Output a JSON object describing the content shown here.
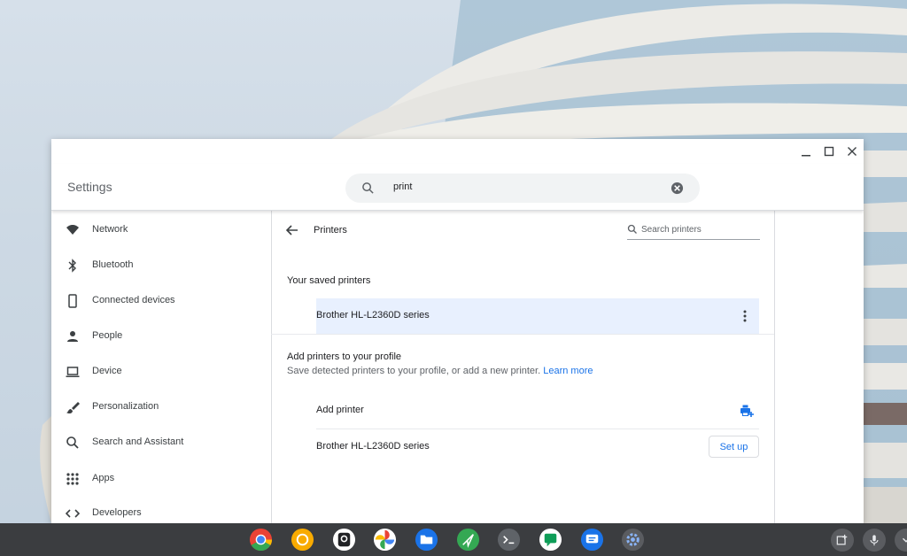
{
  "window": {
    "app_title": "Settings",
    "search": {
      "query": "print"
    }
  },
  "sidebar": {
    "items": [
      {
        "label": "Network",
        "icon": "wifi-icon"
      },
      {
        "label": "Bluetooth",
        "icon": "bluetooth-icon"
      },
      {
        "label": "Connected devices",
        "icon": "phone-icon"
      },
      {
        "label": "People",
        "icon": "person-icon"
      },
      {
        "label": "Device",
        "icon": "laptop-icon"
      },
      {
        "label": "Personalization",
        "icon": "brush-icon"
      },
      {
        "label": "Search and Assistant",
        "icon": "search-icon"
      },
      {
        "label": "Apps",
        "icon": "apps-grid-icon"
      },
      {
        "label": "Developers",
        "icon": "code-icon"
      }
    ]
  },
  "printers": {
    "title": "Printers",
    "search_placeholder": "Search printers",
    "saved_heading": "Your saved printers",
    "saved": [
      {
        "name": "Brother HL-L2360D series"
      }
    ],
    "add_heading": "Add printers to your profile",
    "add_subtitle": "Save detected printers to your profile, or add a new printer.",
    "learn_more": "Learn more",
    "add_printer_label": "Add printer",
    "detected": [
      {
        "name": "Brother HL-L2360D series",
        "action": "Set up"
      }
    ]
  },
  "shelf": {
    "apps": [
      "chrome-icon",
      "canary-icon",
      "camera-icon",
      "photos-icon",
      "files-icon",
      "send-icon",
      "terminal-icon",
      "chat-icon",
      "messages-icon",
      "settings-icon"
    ],
    "tray": [
      "screen-capture-icon",
      "mic-icon",
      "launcher-icon"
    ]
  },
  "colors": {
    "accent": "#1a73e8",
    "selected_row": "#e8f0fe",
    "shelf": "#3b3d40"
  }
}
